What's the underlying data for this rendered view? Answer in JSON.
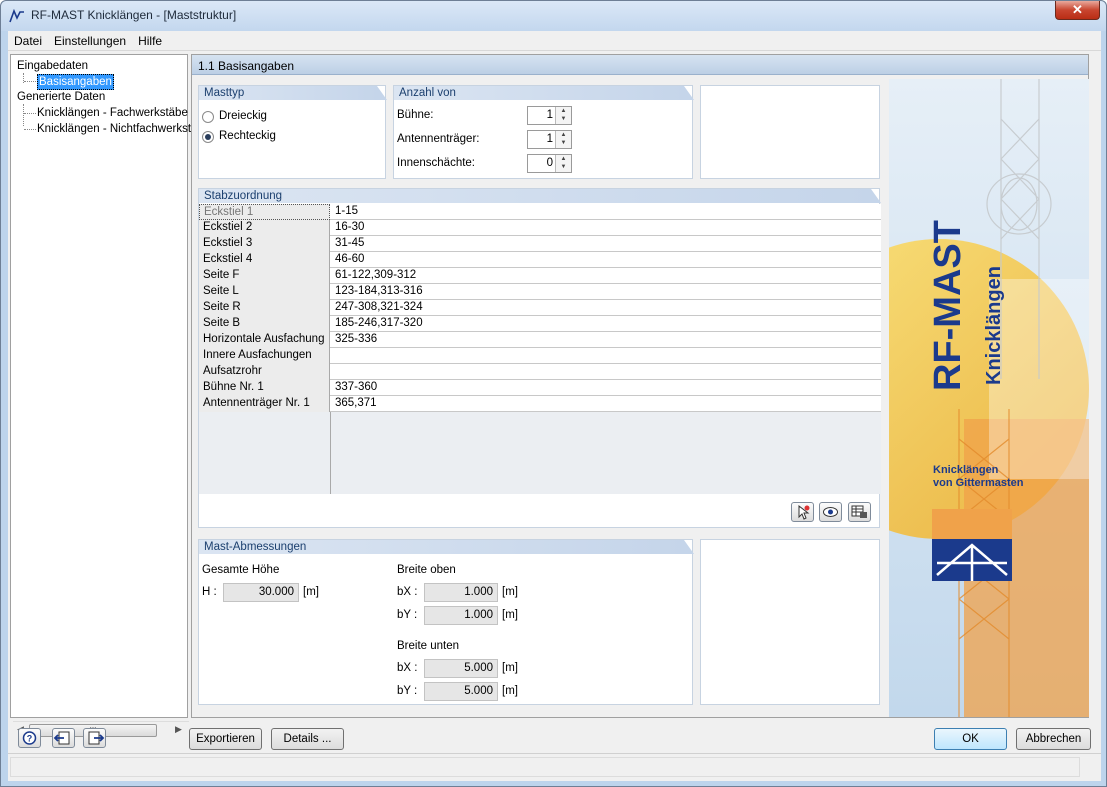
{
  "window": {
    "title": "RF-MAST Knicklängen - [Maststruktur]",
    "close_label": "✕"
  },
  "menu": [
    "Datei",
    "Einstellungen",
    "Hilfe"
  ],
  "tree": {
    "input_root": "Eingabedaten",
    "input_child": "Basisangaben",
    "generated_root": "Generierte Daten",
    "generated_children": [
      "Knicklängen - Fachwerkstäbe",
      "Knicklängen - Nichtfachwerkstä"
    ]
  },
  "main": {
    "header": "1.1 Basisangaben"
  },
  "masttyp": {
    "title": "Masttyp",
    "options": [
      "Dreieckig",
      "Rechteckig"
    ],
    "selected": "Rechteckig"
  },
  "anzahl": {
    "title": "Anzahl von",
    "rows": [
      {
        "label": "Bühne:",
        "value": "1"
      },
      {
        "label": "Antennenträger:",
        "value": "1"
      },
      {
        "label": "Innenschächte:",
        "value": "0"
      }
    ]
  },
  "stabzuordnung": {
    "title": "Stabzuordnung",
    "rows": [
      {
        "name": "Eckstiel 1",
        "value": "1-15"
      },
      {
        "name": "Eckstiel 2",
        "value": "16-30"
      },
      {
        "name": "Eckstiel 3",
        "value": "31-45"
      },
      {
        "name": "Eckstiel 4",
        "value": "46-60"
      },
      {
        "name": "Seite F",
        "value": "61-122,309-312"
      },
      {
        "name": "Seite L",
        "value": "123-184,313-316"
      },
      {
        "name": "Seite R",
        "value": "247-308,321-324"
      },
      {
        "name": "Seite B",
        "value": "185-246,317-320"
      },
      {
        "name": "Horizontale Ausfachung",
        "value": "325-336"
      },
      {
        "name": "Innere Ausfachungen",
        "value": ""
      },
      {
        "name": "Aufsatzrohr",
        "value": ""
      },
      {
        "name": "Bühne Nr. 1",
        "value": "337-360"
      },
      {
        "name": "Antennenträger Nr. 1",
        "value": "365,371"
      }
    ]
  },
  "abmessungen": {
    "title": "Mast-Abmessungen",
    "gesamt_label": "Gesamte Höhe",
    "h_label": "H :",
    "h_value": "30.000",
    "unit": "[m]",
    "breite_oben_label": "Breite oben",
    "bx_label": "bX :",
    "by_label": "bY :",
    "bx_oben": "1.000",
    "by_oben": "1.000",
    "breite_unten_label": "Breite unten",
    "bx_unten": "5.000",
    "by_unten": "5.000"
  },
  "promo": {
    "brand": "RF-MAST",
    "product": "Knicklängen",
    "line1": "Knicklängen",
    "line2": "von Gittermasten"
  },
  "buttons": {
    "export": "Exportieren",
    "details": "Details ...",
    "ok": "OK",
    "cancel": "Abbrechen"
  },
  "colors": {
    "brand_blue": "#1b3a8c",
    "header_blue": "#1b3f6e",
    "promo_yellow": "#f4c431",
    "promo_orange": "#f0a24a"
  }
}
